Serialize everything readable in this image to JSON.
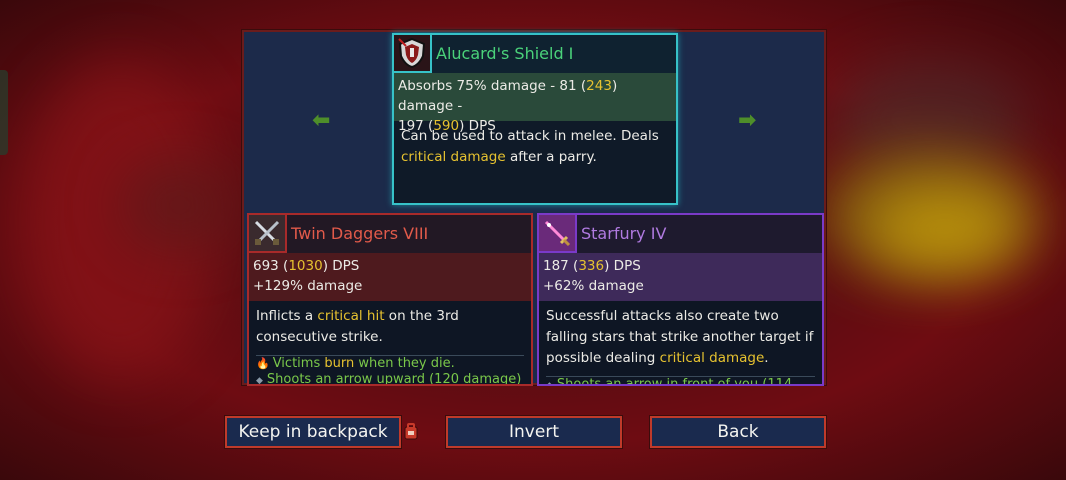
{
  "colors": {
    "panel_bg": "#1c2a4a",
    "top_card_border": "#37c2c8",
    "left_card_border": "#a82a2a",
    "right_card_border": "#7a3ac8",
    "highlight": "#e6c230",
    "button_border": "#c03a2a"
  },
  "nav": {
    "prev_icon": "arrow-left-icon",
    "prev_glyph": "⬅",
    "next_icon": "arrow-right-icon",
    "next_glyph": "➡"
  },
  "new_item": {
    "icon": "shield-icon",
    "name": "Alucard's Shield I",
    "stats": {
      "line1_pre": "Absorbs 75% damage - 81 (",
      "line1_val1": "243",
      "line1_mid": ") damage -",
      "line2_pre": "197 (",
      "line2_val": "590",
      "line2_post": ") DPS"
    },
    "desc": {
      "pre": "Can be used to attack in melee. Deals",
      "hl": "critical damage",
      "post": " after a parry."
    }
  },
  "left_item": {
    "icon": "crossed-daggers-icon",
    "name": "Twin Daggers VIII",
    "stats": {
      "dps_pre": "693 (",
      "dps_val": "1030",
      "dps_post": ") DPS",
      "bonus": "+129% damage"
    },
    "desc": {
      "pre": "Inflicts a ",
      "hl": "critical hit",
      "post": " on the 3rd consecutive strike."
    },
    "sub": [
      {
        "icon": "fire-icon",
        "glyph": "🔥",
        "pre": "Victims ",
        "hl": "burn",
        "post": " when they die."
      },
      {
        "icon": "diamond-bullet-icon",
        "glyph": "◆",
        "text": "Shoots an arrow upward (120 damage)"
      }
    ]
  },
  "right_item": {
    "icon": "star-sword-icon",
    "name": "Starfury IV",
    "stats": {
      "dps_pre": "187 (",
      "dps_val": "336",
      "dps_post": ") DPS",
      "bonus": "+62% damage"
    },
    "desc": {
      "pre": "Successful attacks also create two falling stars that strike another target if possible dealing ",
      "hl": "critical damage",
      "post": "."
    },
    "sub": [
      {
        "icon": "diamond-bullet-icon",
        "glyph": "◆",
        "text": "Shoots an arrow in front of you (114"
      }
    ]
  },
  "buttons": {
    "keep": "Keep in backpack",
    "invert": "Invert",
    "back": "Back",
    "keep_icon": "backpack-icon"
  }
}
